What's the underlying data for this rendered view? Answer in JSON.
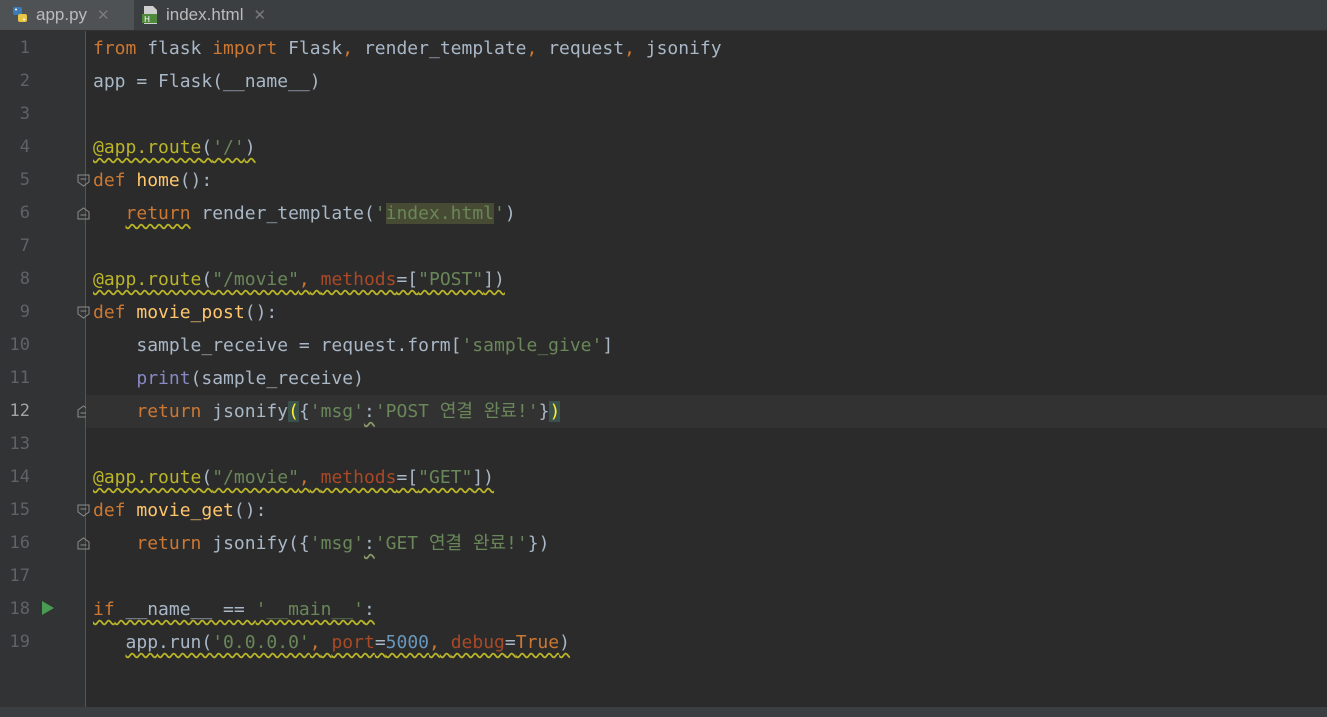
{
  "tabs": [
    {
      "name": "app.py",
      "icon": "python-file-icon",
      "active": true
    },
    {
      "name": "index.html",
      "icon": "html-file-icon",
      "active": false
    }
  ],
  "current_line": 12,
  "line_numbers": [
    "1",
    "2",
    "3",
    "4",
    "5",
    "6",
    "7",
    "8",
    "9",
    "10",
    "11",
    "12",
    "13",
    "14",
    "15",
    "16",
    "17",
    "18",
    "19"
  ],
  "code": {
    "l1": {
      "from": "from",
      "mod": " flask ",
      "import": "import",
      "rest": " Flask",
      "c1": ",",
      "a": " render_template",
      "c2": ",",
      "b": " request",
      "c3": ",",
      "c": " jsonify"
    },
    "l2": {
      "text": "app = Flask(__name__)"
    },
    "l4": {
      "dec": "@app.route",
      "p1": "(",
      "s": "'/'",
      "p2": ")"
    },
    "l5": {
      "def": "def",
      "sp": " ",
      "name": "home",
      "rest": "():"
    },
    "l6": {
      "indent": "   ",
      "ret": "return",
      "call": " render_template(",
      "q1": "'",
      "sel": "index.html",
      "q2": "'",
      "end": ")"
    },
    "l8": {
      "dec": "@app.route",
      "p1": "(",
      "s": "\"/movie\"",
      "c": ",",
      "sp": " ",
      "param": "methods",
      "eq": "=[",
      "s2": "\"POST\"",
      "end": "])"
    },
    "l9": {
      "def": "def",
      "sp": " ",
      "name": "movie_post",
      "rest": "():"
    },
    "l10": {
      "indent": "    ",
      "a": "sample_receive = request.form[",
      "s": "'sample_give'",
      "end": "]"
    },
    "l11": {
      "indent": "    ",
      "bi": "print",
      "rest": "(sample_receive)"
    },
    "l12": {
      "indent": "    ",
      "ret": "return",
      "call": " jsonify",
      "p1": "(",
      "b1": "{",
      "k": "'msg'",
      "colon": ":",
      "v": "'POST 연결 완료!'",
      "b2": "}",
      "p2": ")"
    },
    "l14": {
      "dec": "@app.route",
      "p1": "(",
      "s": "\"/movie\"",
      "c": ",",
      "sp": " ",
      "param": "methods",
      "eq": "=[",
      "s2": "\"GET\"",
      "end": "])"
    },
    "l15": {
      "def": "def",
      "sp": " ",
      "name": "movie_get",
      "rest": "():"
    },
    "l16": {
      "indent": "    ",
      "ret": "return",
      "call": " jsonify({",
      "k": "'msg'",
      "colon": ":",
      "v": "'GET 연결 완료!'",
      "end": "})"
    },
    "l18": {
      "if": "if",
      "a": " __name__ == ",
      "s": "'__main__'",
      "end": ":"
    },
    "l19": {
      "indent": "   ",
      "app": "app",
      "run": ".run(",
      "s": "'0.0.0.0'",
      "c1": ",",
      "sp1": " ",
      "p1": "port",
      "eq1": "=",
      "n": "5000",
      "c2": ",",
      "sp2": " ",
      "p2": "debug",
      "eq2": "=",
      "t": "True",
      "end": ")"
    }
  },
  "colors": {
    "background": "#2b2b2b",
    "keyword": "#cc7832",
    "string": "#6a8759",
    "decorator": "#bbb529",
    "function": "#ffc66d",
    "number": "#6897bb",
    "run_icon": "#499c54"
  }
}
